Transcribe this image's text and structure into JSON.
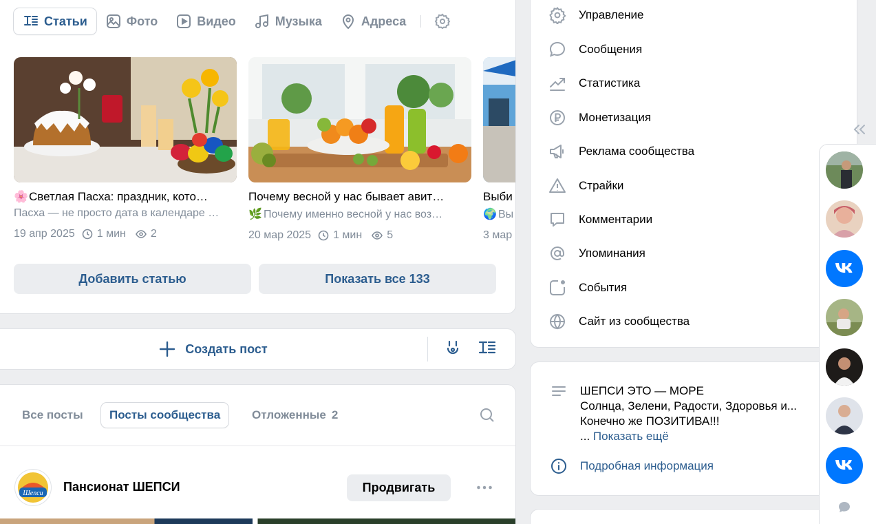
{
  "tabs": [
    {
      "label": "Статьи",
      "icon": "articles-icon",
      "active": true
    },
    {
      "label": "Фото",
      "icon": "photo-icon"
    },
    {
      "label": "Видео",
      "icon": "video-icon"
    },
    {
      "label": "Музыка",
      "icon": "music-icon"
    },
    {
      "label": "Адреса",
      "icon": "location-icon"
    }
  ],
  "articles": [
    {
      "title": "Светлая Пасха: праздник, кото…",
      "snippet": "Пасха — не просто дата в календаре …",
      "date": "19 апр 2025",
      "read_time": "1 мин",
      "views": "2"
    },
    {
      "title": "Почему весной у нас бывает авит…",
      "snippet": "Почему именно весной у нас воз…",
      "date": "20 мар 2025",
      "read_time": "1 мин",
      "views": "5"
    },
    {
      "title": "Выби",
      "snippet": "Вы",
      "date": "3 мар"
    }
  ],
  "buttons": {
    "add_article": "Добавить статью",
    "show_all": "Показать все 133",
    "create_post": "Создать пост",
    "promote": "Продвигать"
  },
  "post_filters": [
    {
      "label": "Все посты"
    },
    {
      "label": "Посты сообщества",
      "active": true
    },
    {
      "label": "Отложенные",
      "count": "2"
    }
  ],
  "post": {
    "author": "Пансионат ШЕПСИ",
    "logo_text": "Шепси"
  },
  "side_menu": [
    {
      "label": "Управление",
      "icon": "gear-icon"
    },
    {
      "label": "Сообщения",
      "icon": "message-icon"
    },
    {
      "label": "Статистика",
      "icon": "stats-icon"
    },
    {
      "label": "Монетизация",
      "icon": "ruble-icon"
    },
    {
      "label": "Реклама сообщества",
      "icon": "megaphone-icon"
    },
    {
      "label": "Страйки",
      "icon": "warning-icon"
    },
    {
      "label": "Комментарии",
      "icon": "comment-icon"
    },
    {
      "label": "Упоминания",
      "icon": "at-icon"
    },
    {
      "label": "События",
      "icon": "events-icon"
    },
    {
      "label": "Сайт из сообщества",
      "icon": "globe-icon"
    }
  ],
  "about": {
    "line1": "ШЕПСИ ЭТО — МОРЕ",
    "line2": "Солнца, Зелени, Радости, Здоровья и...",
    "line3": "Конечно же ПОЗИТИВА!!!",
    "ellipsis": "...",
    "show_more": "Показать ещё",
    "details": "Подробная информация"
  },
  "colors": {
    "accent": "#2c5d8f",
    "vk_blue": "#0077ff",
    "muted": "#818c99",
    "bg": "#edeef0"
  }
}
